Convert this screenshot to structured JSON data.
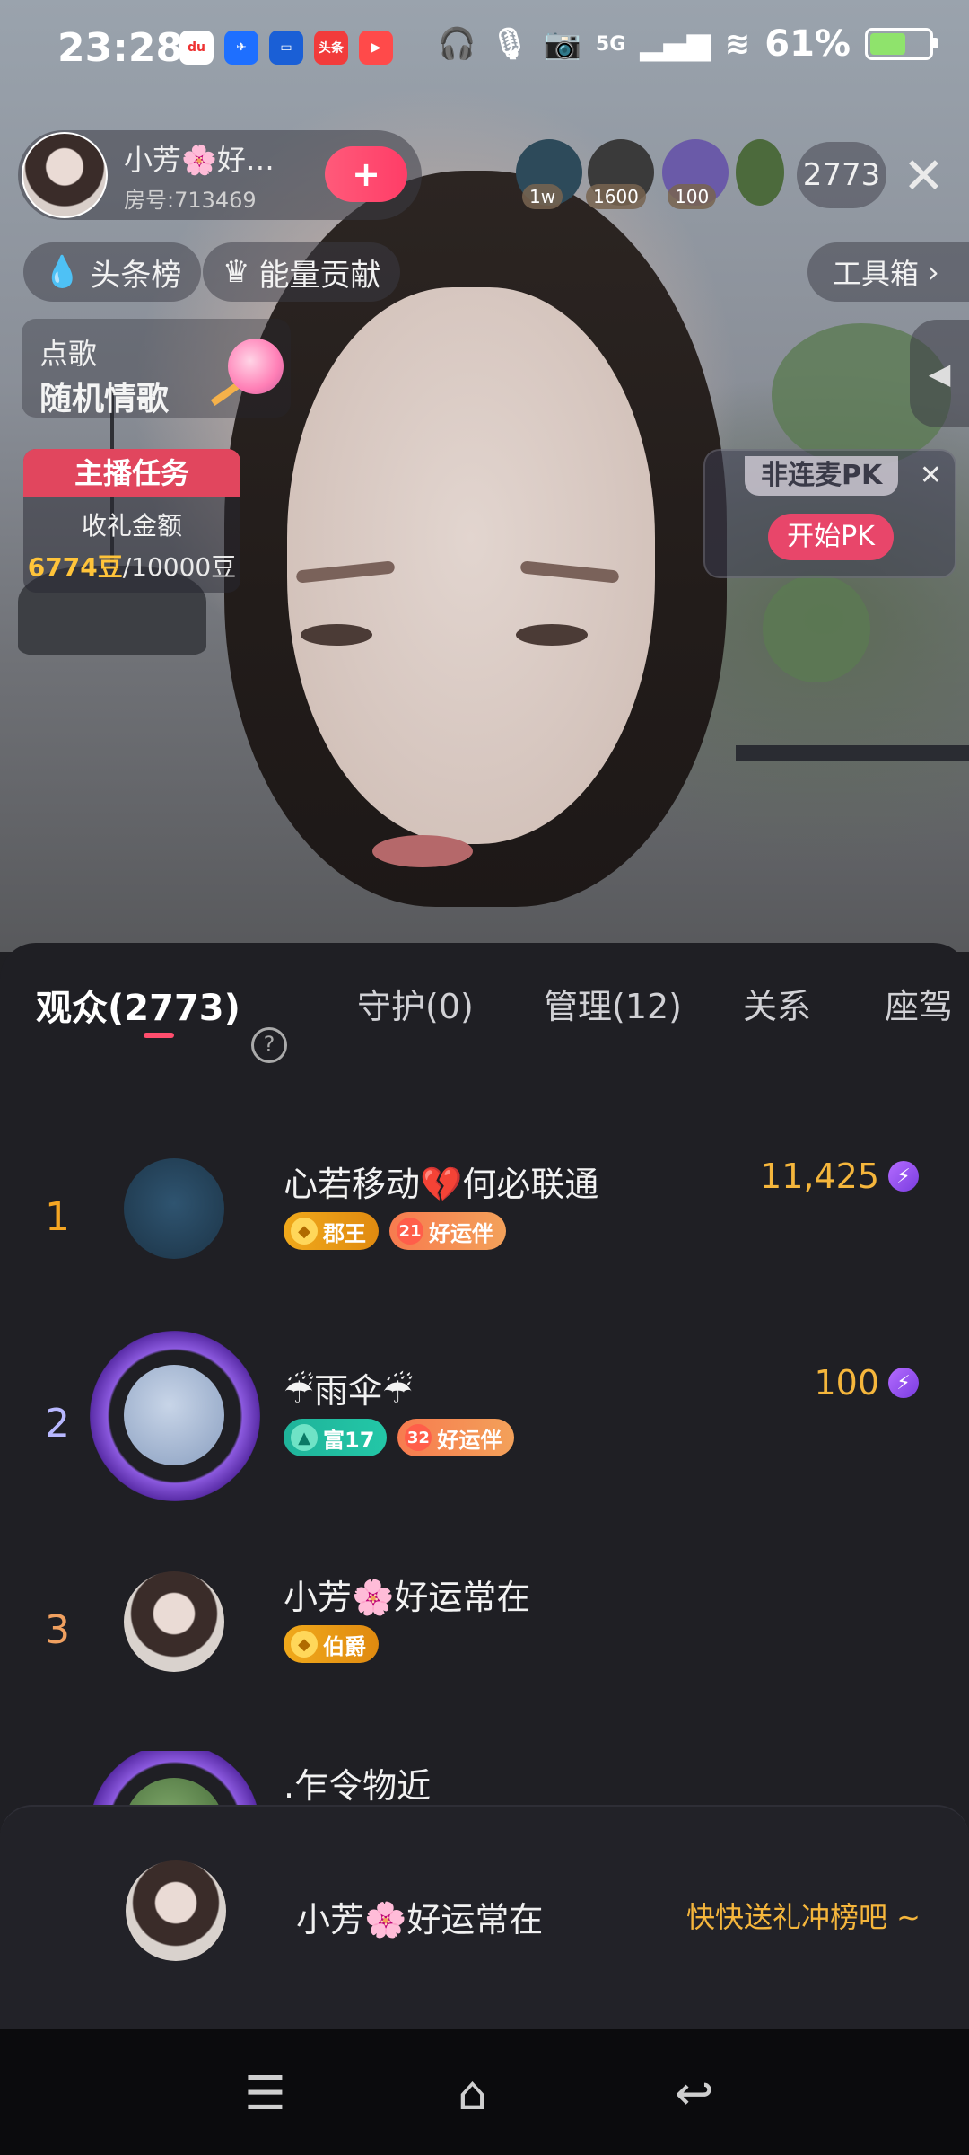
{
  "status_bar": {
    "time": "23:28",
    "app_icons": [
      {
        "name": "dewu-icon",
        "label": "du",
        "color": "#ffffff"
      },
      {
        "name": "feishu-icon",
        "label": "",
        "color": "#1e6fff"
      },
      {
        "name": "message-app-icon",
        "label": "",
        "color": "#1a5fd6"
      },
      {
        "name": "toutiao-icon",
        "label": "头条",
        "color": "#f23b3b"
      },
      {
        "name": "video-app-icon",
        "label": "▶",
        "color": "#ff4a4a"
      }
    ],
    "network": "5G",
    "battery": "61%",
    "battery_level": 0.61
  },
  "host": {
    "name": "小芳🌸好…",
    "room": "房号:713469",
    "follow_label": "+"
  },
  "top_viewers": [
    {
      "badge": "1w",
      "color": "#2d4a5a"
    },
    {
      "badge": "1600",
      "color": "#3a3a3a"
    },
    {
      "badge": "100",
      "color": "#6a5aa8"
    },
    {
      "badge": "",
      "color": "#4c6a3c"
    }
  ],
  "viewer_count": "2773",
  "chips": {
    "headline_board": "头条榜",
    "energy": "能量贡献",
    "toolbox": "工具箱"
  },
  "song": {
    "title": "点歌",
    "subtitle": "随机情歌"
  },
  "task": {
    "title": "主播任务",
    "label": "收礼金额",
    "current": "6774豆",
    "target": "/10000豆"
  },
  "pk": {
    "title": "非连麦PK",
    "button": "开始PK"
  },
  "tabs": [
    {
      "label": "观众(2773)",
      "active": true
    },
    {
      "label": "守护(0)",
      "active": false
    },
    {
      "label": "管理(12)",
      "active": false
    },
    {
      "label": "关系",
      "active": false
    },
    {
      "label": "座驾",
      "active": false
    }
  ],
  "audience": [
    {
      "rank": "1",
      "name": "心若移动💔何必联通",
      "score": "11,425",
      "badges": [
        {
          "icon": "◆",
          "label": "郡王",
          "type": "rank"
        },
        {
          "icon": "21",
          "label": "好运伴",
          "type": "luck"
        }
      ]
    },
    {
      "rank": "2",
      "name": "☔雨伞☔",
      "score": "100",
      "badges": [
        {
          "icon": "▲",
          "label": "富17",
          "type": "wealth"
        },
        {
          "icon": "32",
          "label": "好运伴",
          "type": "luck"
        }
      ]
    },
    {
      "rank": "3",
      "name": "小芳🌸好运常在",
      "score": "",
      "badges": [
        {
          "icon": "◆",
          "label": "伯爵",
          "type": "rank"
        }
      ]
    },
    {
      "rank": "",
      "name": ".乍令物近",
      "score": "",
      "badges": []
    }
  ],
  "self": {
    "name": "小芳🌸好运常在",
    "cta": "快快送礼冲榜吧 ~"
  },
  "colors": {
    "accent": "#ff4d6d",
    "gold": "#f5b63c",
    "rank1": "#f5a623",
    "rank2": "#b8b8ff",
    "rank3": "#f0a060"
  }
}
